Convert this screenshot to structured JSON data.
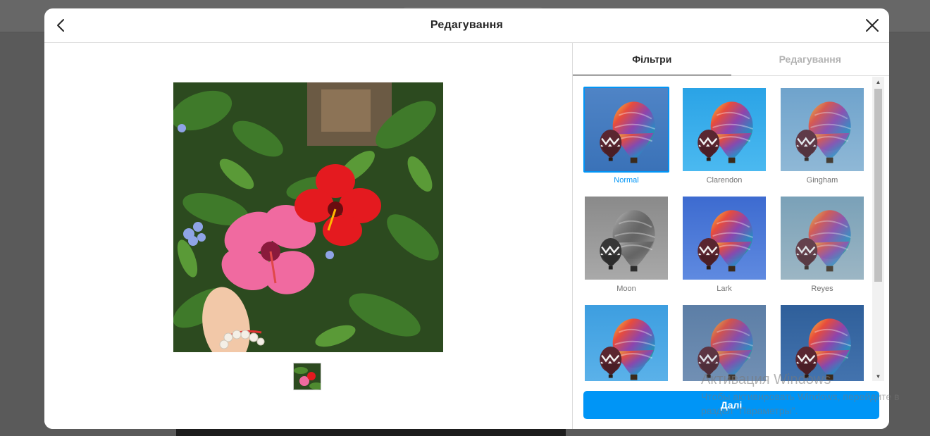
{
  "modal": {
    "title": "Редагування",
    "back_icon": "chevron-left-icon",
    "close_icon": "close-icon"
  },
  "tabs": [
    {
      "label": "Фільтри",
      "active": true
    },
    {
      "label": "Редагування",
      "active": false
    }
  ],
  "filters": [
    {
      "name": "Normal",
      "selected": true
    },
    {
      "name": "Clarendon",
      "selected": false
    },
    {
      "name": "Gingham",
      "selected": false
    },
    {
      "name": "Moon",
      "selected": false
    },
    {
      "name": "Lark",
      "selected": false
    },
    {
      "name": "Reyes",
      "selected": false
    },
    {
      "name": "",
      "selected": false
    },
    {
      "name": "",
      "selected": false
    },
    {
      "name": "",
      "selected": false
    }
  ],
  "next_button": {
    "label": "Далі"
  },
  "watermark": {
    "title": "Активация Windows",
    "line1": "Чтобы активировать Windows, перейдите в",
    "line2": "раздел \"Параметры\"."
  },
  "colors": {
    "accent": "#0095f6",
    "title_text": "#262626",
    "inactive_tab": "#b3b3b3",
    "border": "#dbdbdb"
  }
}
